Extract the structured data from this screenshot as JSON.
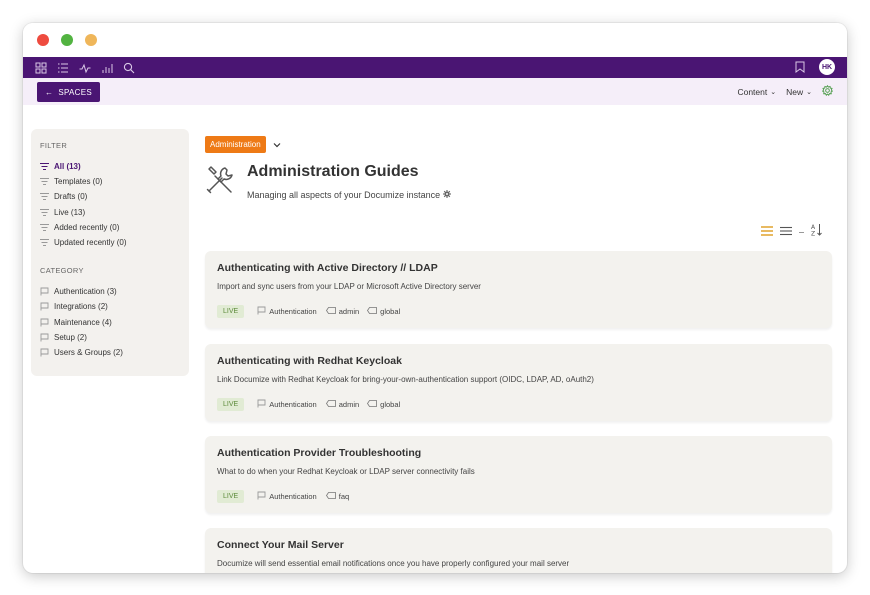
{
  "window": {
    "controls": [
      "close",
      "maximize",
      "minimize"
    ]
  },
  "topbar": {
    "icons": [
      "grid-icon",
      "list-icon",
      "activity-icon",
      "chart-icon",
      "search-icon"
    ],
    "avatar_initials": "HK",
    "accent_color": "#4a1573"
  },
  "subbar": {
    "spaces_label": "SPACES",
    "content_label": "Content",
    "new_label": "New"
  },
  "sidebar": {
    "filter_title": "FILTER",
    "filters": [
      {
        "label": "All (13)",
        "active": true
      },
      {
        "label": "Templates (0)"
      },
      {
        "label": "Drafts (0)"
      },
      {
        "label": "Live (13)"
      },
      {
        "label": "Added recently (0)"
      },
      {
        "label": "Updated recently (0)"
      }
    ],
    "category_title": "CATEGORY",
    "categories": [
      {
        "label": "Authentication (3)"
      },
      {
        "label": "Integrations (2)"
      },
      {
        "label": "Maintenance (4)"
      },
      {
        "label": "Setup (2)"
      },
      {
        "label": "Users & Groups (2)"
      }
    ]
  },
  "main": {
    "space_label": "Administration",
    "space_color": "#ee7a16",
    "title": "Administration Guides",
    "description": "Managing all aspects of your Documize instance"
  },
  "documents": [
    {
      "title": "Authenticating with Active Directory // LDAP",
      "excerpt": "Import and sync users from your LDAP or Microsoft Active Directory server",
      "status": "LIVE",
      "category": "Authentication",
      "tags": [
        "admin",
        "global"
      ]
    },
    {
      "title": "Authenticating with Redhat Keycloak",
      "excerpt": "Link Documize with Redhat Keycloak for bring-your-own-authentication support (OIDC, LDAP, AD, oAuth2)",
      "status": "LIVE",
      "category": "Authentication",
      "tags": [
        "admin",
        "global"
      ]
    },
    {
      "title": "Authentication Provider Troubleshooting",
      "excerpt": "What to do when your Redhat Keycloak or LDAP server connectivity fails",
      "status": "LIVE",
      "category": "Authentication",
      "tags": [
        "faq"
      ]
    },
    {
      "title": "Connect Your Mail Server",
      "excerpt": "Documize will send essential email notifications once you have properly configured your mail server"
    }
  ]
}
